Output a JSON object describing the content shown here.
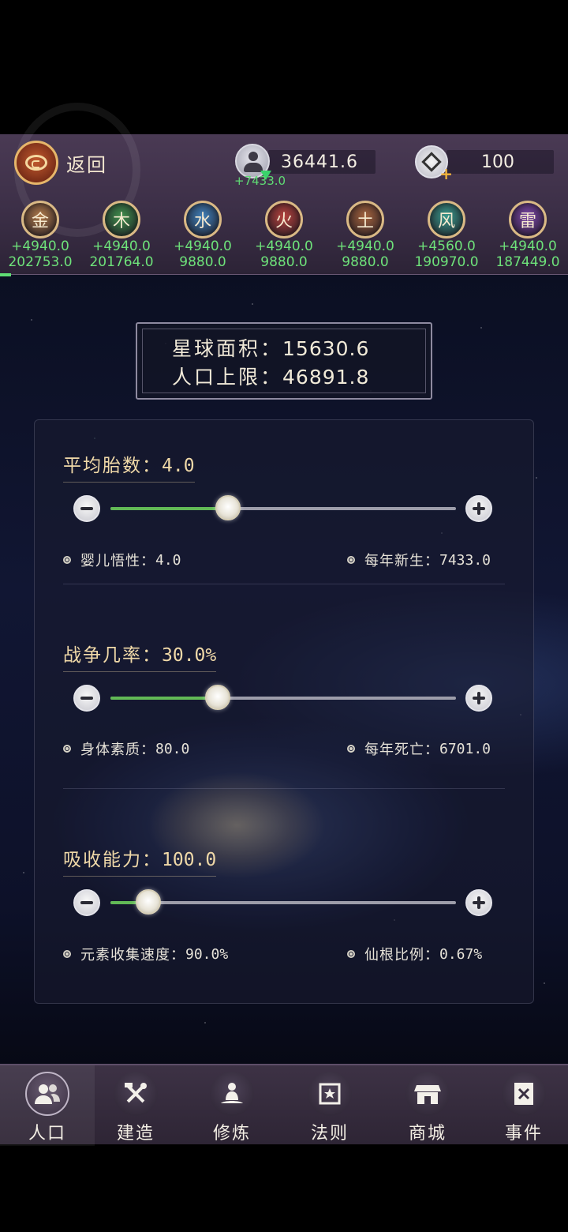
{
  "header": {
    "back_label": "返回",
    "population": {
      "value": "36441.6",
      "delta": "+7433.0",
      "icon": "population-icon"
    },
    "gems": {
      "value": "100",
      "icon": "gem-plus-icon"
    }
  },
  "elements": [
    {
      "name": "金",
      "delta": "+4940.0",
      "total": "202753.0",
      "color": "#b07a4a"
    },
    {
      "name": "木",
      "delta": "+4940.0",
      "total": "201764.0",
      "color": "#3f8e4c"
    },
    {
      "name": "水",
      "delta": "+4940.0",
      "total": "9880.0",
      "color": "#3f7fb8"
    },
    {
      "name": "火",
      "delta": "+4940.0",
      "total": "9880.0",
      "color": "#b5413c"
    },
    {
      "name": "土",
      "delta": "+4940.0",
      "total": "9880.0",
      "color": "#a4623c"
    },
    {
      "name": "风",
      "delta": "+4560.0",
      "total": "190970.0",
      "color": "#3a9a8c"
    },
    {
      "name": "雷",
      "delta": "+4940.0",
      "total": "187449.0",
      "color": "#7b45a8"
    }
  ],
  "planet": {
    "area_label": "星球面积：",
    "area_value": "15630.6",
    "pop_cap_label": "人口上限：",
    "pop_cap_value": "46891.8"
  },
  "sections": [
    {
      "title": "平均胎数：",
      "value": "4.0",
      "slider_level": 0.34,
      "left_stat_label": "婴儿悟性：",
      "left_stat_value": "4.0",
      "right_stat_label": "每年新生：",
      "right_stat_value": "7433.0"
    },
    {
      "title": "战争几率：",
      "value": "30.0%",
      "slider_level": 0.31,
      "left_stat_label": "身体素质：",
      "left_stat_value": "80.0",
      "right_stat_label": "每年死亡：",
      "right_stat_value": "6701.0"
    },
    {
      "title": "吸收能力：",
      "value": "100.0",
      "slider_level": 0.11,
      "left_stat_label": "元素收集速度：",
      "left_stat_value": "90.0%",
      "right_stat_label": "仙根比例：",
      "right_stat_value": "0.67%"
    }
  ],
  "nav": [
    {
      "label": "人口",
      "icon": "people-icon",
      "active": true
    },
    {
      "label": "建造",
      "icon": "build-tools-icon",
      "active": false
    },
    {
      "label": "修炼",
      "icon": "meditation-icon",
      "active": false
    },
    {
      "label": "法则",
      "icon": "law-scroll-icon",
      "active": false
    },
    {
      "label": "商城",
      "icon": "shop-icon",
      "active": false
    },
    {
      "label": "事件",
      "icon": "event-book-icon",
      "active": false
    }
  ]
}
